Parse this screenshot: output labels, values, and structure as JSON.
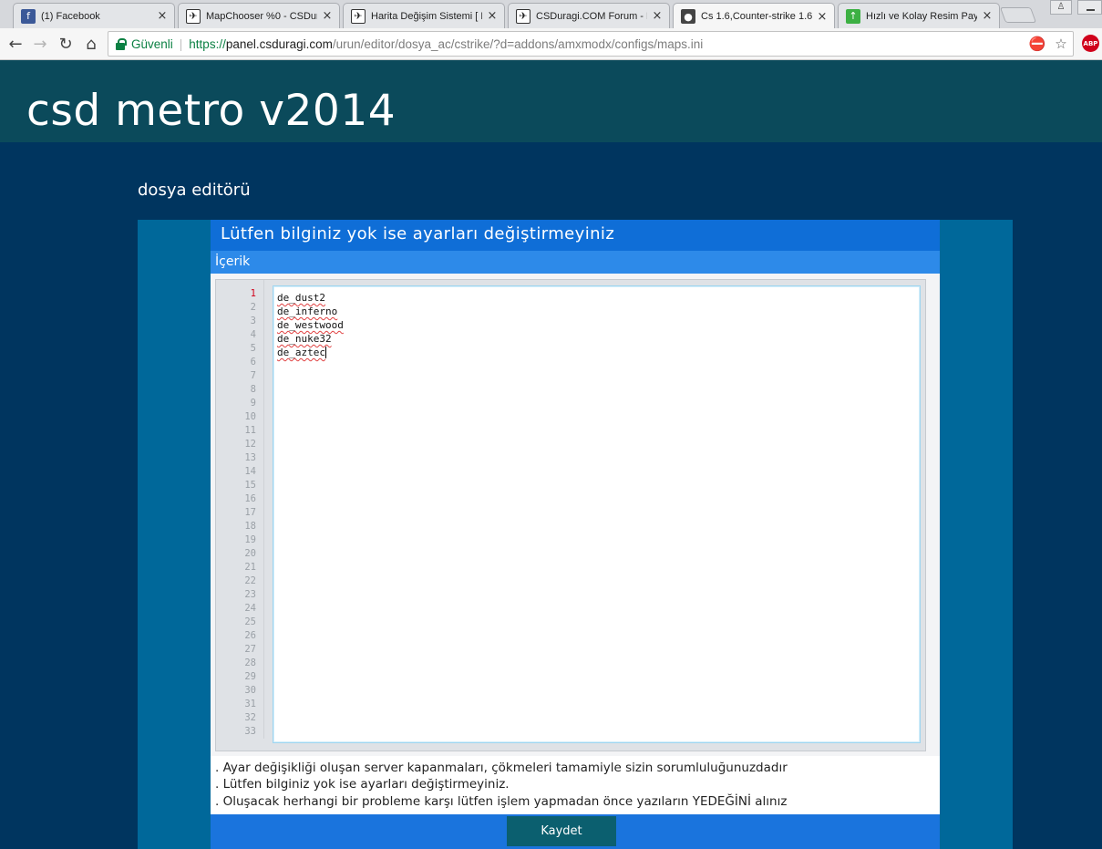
{
  "browser": {
    "tabs": [
      {
        "title": "(1) Facebook",
        "icon": "facebook-icon",
        "active": false
      },
      {
        "title": "MapChooser %0 - CSDur",
        "icon": "counter-strike-icon",
        "active": false
      },
      {
        "title": "Harita Değişim Sistemi [ M",
        "icon": "counter-strike-icon",
        "active": false
      },
      {
        "title": "CSDuragi.COM Forum - B",
        "icon": "counter-strike-icon",
        "active": false
      },
      {
        "title": "Cs 1.6,Counter-strike 1.6",
        "icon": "csduragi-icon",
        "active": true
      },
      {
        "title": "Hızlı ve Kolay Resim Payla",
        "icon": "upload-icon",
        "active": false
      }
    ],
    "secure_label": "Güvenli",
    "url_scheme": "https://",
    "url_host": "panel.csduragi.com",
    "url_path": "/urun/editor/dosya_ac/cstrike/?d=addons/amxmodx/configs/maps.ini",
    "abp_label": "ABP"
  },
  "site": {
    "title": "csd metro v2014"
  },
  "page": {
    "heading": "dosya editörü",
    "panel_title": "Lütfen bilginiz yok ise ayarları değiştirmeyiniz",
    "content_label": "İçerik"
  },
  "editor": {
    "line_count": 33,
    "current_line": 1,
    "lines": [
      "de_dust2",
      "de_inferno",
      "de_westwood",
      "de_nuke32",
      "de_aztec"
    ]
  },
  "notes": [
    ". Ayar değişikliği oluşan server kapanmaları, çökmeleri tamamiyle sizin sorumluluğunuzdadır",
    ". Lütfen bilginiz yok ise ayarları değiştirmeyiniz.",
    ". Oluşacak herhangi bir probleme karşı lütfen işlem yapmadan önce yazıların YEDEĞİNİ alınız"
  ],
  "actions": {
    "save_label": "Kaydet"
  },
  "colors": {
    "header_bg": "#0b4a5b",
    "page_bg": "#00355f",
    "panel_bg": "#0f6ed7",
    "save_button_bg": "#0b5f6f"
  }
}
